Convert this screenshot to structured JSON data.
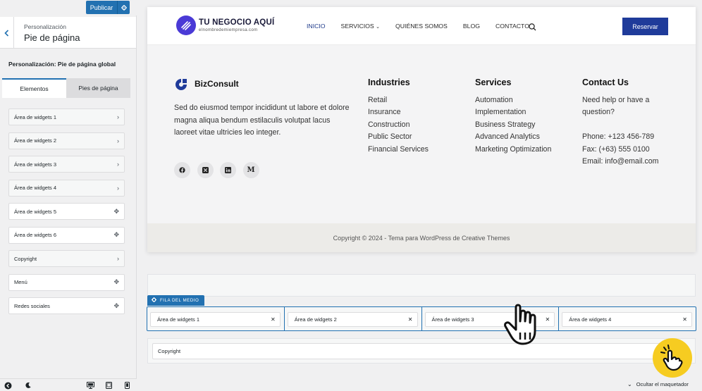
{
  "sidebar": {
    "publish_label": "Publicar",
    "crumb": "Personalización",
    "title": "Pie de página",
    "section_title": "Personalización: Pie de página global",
    "tabs": [
      {
        "label": "Elementos"
      },
      {
        "label": "Pies de página"
      }
    ],
    "items": [
      {
        "label": "Área de widgets 1",
        "icon": "chevron-right-icon"
      },
      {
        "label": "Área de widgets 2",
        "icon": "chevron-right-icon"
      },
      {
        "label": "Área de widgets 3",
        "icon": "chevron-right-icon"
      },
      {
        "label": "Área de widgets 4",
        "icon": "chevron-right-icon"
      },
      {
        "label": "Área de widgets 5",
        "icon": "move-icon"
      },
      {
        "label": "Área de widgets 6",
        "icon": "move-icon"
      },
      {
        "label": "Copyright",
        "icon": "chevron-right-icon"
      },
      {
        "label": "Menú",
        "icon": "move-icon"
      },
      {
        "label": "Redes sociales",
        "icon": "move-icon"
      }
    ]
  },
  "site": {
    "logo_name": "TU NEGOCIO AQUÍ",
    "logo_sub": "elnombredemiempresa.com",
    "nav": [
      "INICIO",
      "SERVICIOS",
      "QUIÉNES SOMOS",
      "BLOG",
      "CONTACTO"
    ],
    "reserve_label": "Reservar",
    "accent": "#1f3b9a"
  },
  "footer": {
    "brand_name": "BizConsult",
    "brand_desc": "Sed do eiusmod tempor incididunt ut labore et dolore magna aliqua bendum estilaculis volutpat lacus laoreet vitae ultricies leo integer.",
    "socials": [
      "facebook-icon",
      "x-icon",
      "linkedin-icon",
      "medium-icon"
    ],
    "columns": [
      {
        "title": "Industries",
        "links": [
          "Retail",
          "Insurance",
          "Construction",
          "Public Sector",
          "Financial Services"
        ]
      },
      {
        "title": "Services",
        "links": [
          "Automation",
          "Implementation",
          "Business Strategy",
          "Advanced Analytics",
          "Marketing Optimization"
        ]
      },
      {
        "title": "Contact Us",
        "lines": [
          "Need help or have a",
          "question?",
          "",
          "Phone: +123 456-789",
          "Fax: (+63) 555 0100",
          "Email: info@email.com"
        ]
      }
    ],
    "copyright": "Copyright © 2024 - Tema para WordPress de Creative Themes"
  },
  "builder": {
    "row_label": "FILA DEL MEDIO",
    "columns": [
      "Área de widgets 1",
      "Área de widgets 2",
      "Área de widgets 3",
      "Área de widgets 4"
    ],
    "bottom_item": "Copyright",
    "hide_label": "Ocultar el maquetador",
    "accent": "#2271b1"
  }
}
